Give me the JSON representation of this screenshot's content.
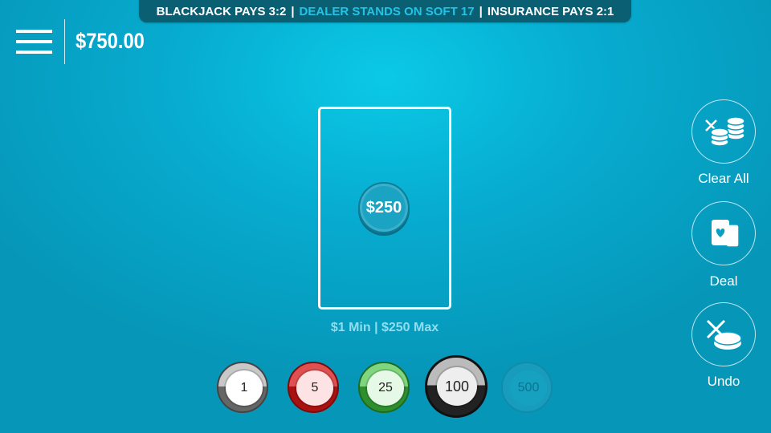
{
  "rules": {
    "blackjack": "BLACKJACK PAYS 3:2",
    "dealer": "DEALER STANDS ON SOFT 17",
    "insurance": "INSURANCE PAYS 2:1",
    "separator": "|"
  },
  "header": {
    "balance": "$750.00",
    "menu_icon": "hamburger-menu-icon"
  },
  "table": {
    "bet_amount": "$250",
    "limits": "$1 Min | $250 Max"
  },
  "chips": [
    {
      "label": "1",
      "color": "#777777"
    },
    {
      "label": "5",
      "color": "#c21f1f"
    },
    {
      "label": "25",
      "color": "#3aa53a"
    },
    {
      "label": "100",
      "color": "#111111"
    },
    {
      "label": "500",
      "color": "#1b9ebe"
    }
  ],
  "actions": {
    "clear_all": "Clear All",
    "deal": "Deal",
    "undo": "Undo"
  },
  "colors": {
    "felt": "#07acd0",
    "rules_bar": "#0a5f73",
    "accent": "#21c4e6"
  }
}
